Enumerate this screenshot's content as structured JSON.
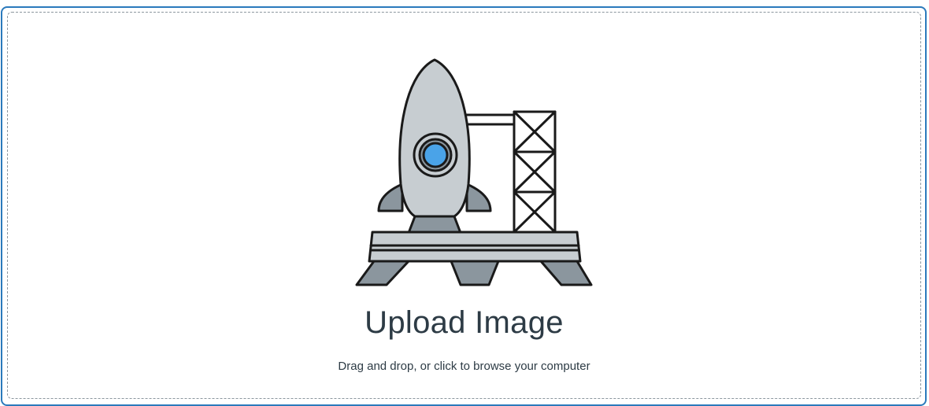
{
  "upload": {
    "title": "Upload Image",
    "subtitle": "Drag and drop, or click to browse your computer",
    "illustration_icon": "rocket-launchpad-icon"
  },
  "colors": {
    "focus_border": "#2b7abc",
    "dashed_border": "#8b969e",
    "text": "#2d3b45",
    "rocket_body": "#c7cdd1",
    "rocket_fin": "#8b969e",
    "window": "#4aa3e8",
    "outline": "#1a1a1a"
  }
}
